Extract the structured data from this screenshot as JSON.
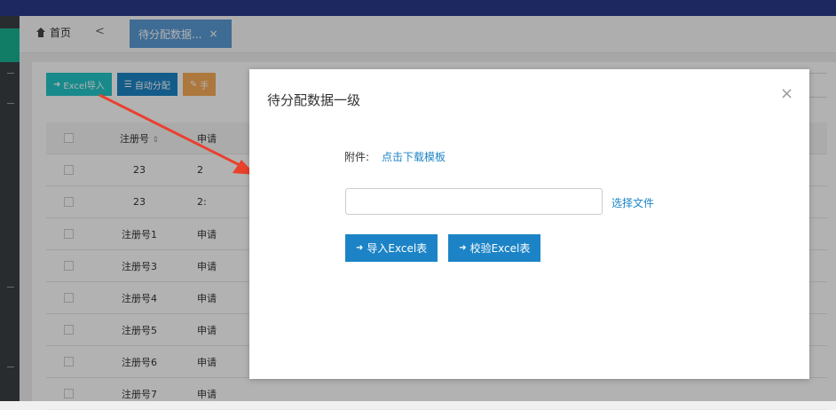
{
  "tabs": {
    "home_label": "首页",
    "prev_arrow": "<",
    "active_label": "待分配数据...",
    "close_symbol": "×"
  },
  "toolbar": {
    "excel_import": "Excel导入",
    "auto_assign": "自动分配",
    "manual_partial": "手"
  },
  "table": {
    "header": {
      "reg_no": "注册号",
      "app_partial": "申请"
    },
    "rows": [
      {
        "reg_no": "23",
        "app": "2"
      },
      {
        "reg_no": "23",
        "app": "2:"
      },
      {
        "reg_no": "注册号1",
        "app": "申请"
      },
      {
        "reg_no": "注册号3",
        "app": "申请"
      },
      {
        "reg_no": "注册号4",
        "app": "申请"
      },
      {
        "reg_no": "注册号5",
        "app": "申请"
      },
      {
        "reg_no": "注册号6",
        "app": "申请"
      },
      {
        "reg_no": "注册号7",
        "app": "申请"
      }
    ]
  },
  "modal": {
    "title": "待分配数据一级",
    "close_symbol": "×",
    "attach_label": "附件:",
    "download_template": "点击下载模板",
    "file_value": "",
    "choose_file": "选择文件",
    "import_excel": "导入Excel表",
    "validate_excel": "校验Excel表"
  },
  "colors": {
    "primary": "#1c84c6",
    "annotation_arrow": "#e8412c",
    "top_bar": "#2a3a8c",
    "sidebar_accent": "#1ab394"
  },
  "icons": {
    "home": "home-icon",
    "import": "sign-in-icon",
    "list": "list-icon",
    "edit": "edit-icon",
    "sort": "sort-icon"
  }
}
